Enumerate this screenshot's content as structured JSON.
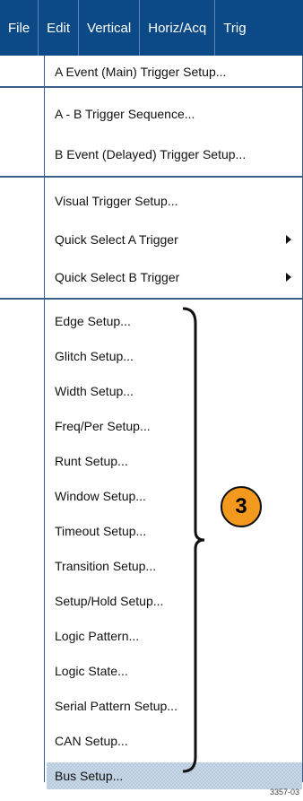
{
  "menubar": [
    "File",
    "Edit",
    "Vertical",
    "Horiz/Acq",
    "Trig"
  ],
  "menu": {
    "items": [
      "A Event (Main) Trigger Setup...",
      "A - B Trigger Sequence...",
      "B Event (Delayed) Trigger Setup...",
      "Visual Trigger Setup...",
      "Quick Select A Trigger",
      "Quick Select B Trigger",
      "Edge Setup...",
      "Glitch Setup...",
      "Width Setup...",
      "Freq/Per Setup...",
      "Runt Setup...",
      "Window Setup...",
      "Timeout Setup...",
      "Transition Setup...",
      "Setup/Hold Setup...",
      "Logic Pattern...",
      "Logic State...",
      "Serial Pattern Setup...",
      "CAN Setup...",
      "Bus Setup..."
    ],
    "submenu_arrow_icon": "chevron-right-icon",
    "highlighted_item": "Bus Setup..."
  },
  "callout": {
    "label": "3",
    "color": "#f39a1e"
  },
  "figure_id": "3357-03",
  "colors": {
    "menubar_bg": "#0b4a86",
    "separator": "#3a5f8d"
  }
}
